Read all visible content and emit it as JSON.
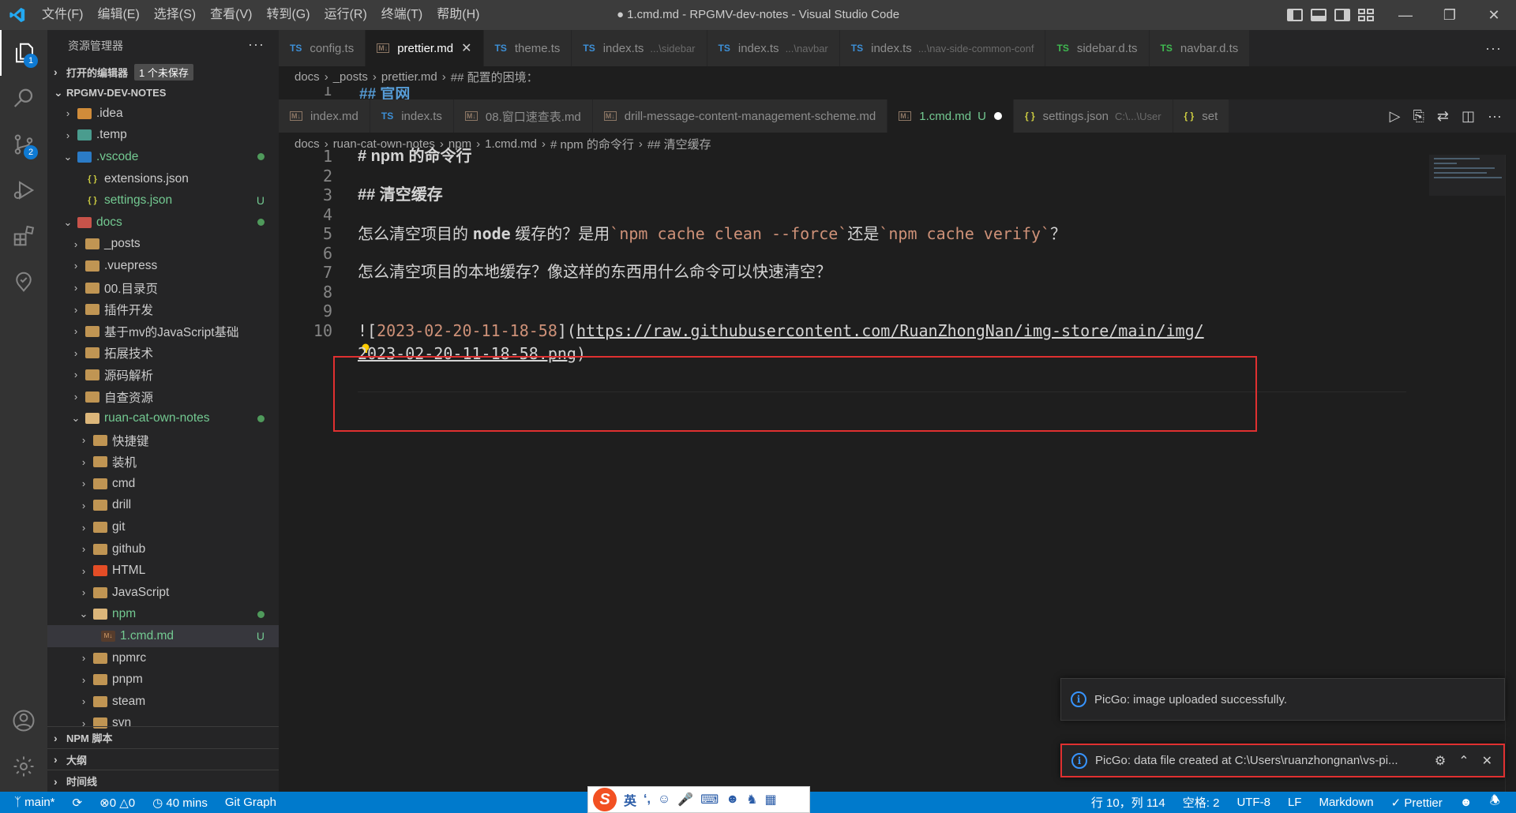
{
  "window": {
    "title": "● 1.cmd.md - RPGMV-dev-notes - Visual Studio Code",
    "menu": [
      "文件(F)",
      "编辑(E)",
      "选择(S)",
      "查看(V)",
      "转到(G)",
      "运行(R)",
      "终端(T)",
      "帮助(H)"
    ]
  },
  "activity": {
    "explorer_badge": "1",
    "scm_badge": "2"
  },
  "sidebar": {
    "header": "资源管理器",
    "open_editors": {
      "label": "打开的编辑器",
      "unsaved": "1 个未保存"
    },
    "root": "RPGMV-DEV-NOTES",
    "tree": [
      {
        "label": ".idea",
        "depth": 1,
        "open": false,
        "icon": "idea"
      },
      {
        "label": ".temp",
        "depth": 1,
        "open": false,
        "icon": "temp"
      },
      {
        "label": ".vscode",
        "depth": 1,
        "open": true,
        "icon": "vscode",
        "dot": true,
        "green": true
      },
      {
        "label": "extensions.json",
        "depth": 2,
        "file": "json"
      },
      {
        "label": "settings.json",
        "depth": 2,
        "file": "json",
        "status": "U",
        "green": true
      },
      {
        "label": "docs",
        "depth": 1,
        "open": true,
        "icon": "docs",
        "dot": true,
        "green": true
      },
      {
        "label": "_posts",
        "depth": 2
      },
      {
        "label": ".vuepress",
        "depth": 2
      },
      {
        "label": "00.目录页",
        "depth": 2
      },
      {
        "label": "插件开发",
        "depth": 2
      },
      {
        "label": "基于mv的JavaScript基础",
        "depth": 2
      },
      {
        "label": "拓展技术",
        "depth": 2
      },
      {
        "label": "源码解析",
        "depth": 2
      },
      {
        "label": "自查资源",
        "depth": 2
      },
      {
        "label": "ruan-cat-own-notes",
        "depth": 2,
        "open": true,
        "dot": true,
        "green": true
      },
      {
        "label": "快捷键",
        "depth": 3
      },
      {
        "label": "装机",
        "depth": 3
      },
      {
        "label": "cmd",
        "depth": 3
      },
      {
        "label": "drill",
        "depth": 3
      },
      {
        "label": "git",
        "depth": 3
      },
      {
        "label": "github",
        "depth": 3
      },
      {
        "label": "HTML",
        "depth": 3,
        "icon": "html"
      },
      {
        "label": "JavaScript",
        "depth": 3
      },
      {
        "label": "npm",
        "depth": 3,
        "open": true,
        "dot": true,
        "green": true
      },
      {
        "label": "1.cmd.md",
        "depth": 4,
        "file": "md",
        "status": "U",
        "green": true,
        "selected": true
      },
      {
        "label": "npmrc",
        "depth": 3
      },
      {
        "label": "pnpm",
        "depth": 3
      },
      {
        "label": "steam",
        "depth": 3
      },
      {
        "label": "svn",
        "depth": 3
      }
    ],
    "bottom_sections": [
      "NPM 脚本",
      "大纲",
      "时间线"
    ]
  },
  "group1": {
    "tabs": [
      {
        "label": "config.ts",
        "kind": "ts"
      },
      {
        "label": "prettier.md",
        "kind": "md",
        "active": true,
        "close": true
      },
      {
        "label": "theme.ts",
        "kind": "ts"
      },
      {
        "label": "index.ts",
        "kind": "ts",
        "desc": "...\\sidebar"
      },
      {
        "label": "index.ts",
        "kind": "ts",
        "desc": "...\\navbar"
      },
      {
        "label": "index.ts",
        "kind": "ts",
        "desc": "...\\nav-side-common-conf"
      },
      {
        "label": "sidebar.d.ts",
        "kind": "dts"
      },
      {
        "label": "navbar.d.ts",
        "kind": "dts"
      }
    ],
    "breadcrumb": [
      "docs",
      "_posts",
      "prettier.md",
      "## 配置的困境："
    ],
    "peek_line": {
      "num": "1",
      "text": "## 官网"
    }
  },
  "group2": {
    "tabs": [
      {
        "label": "index.md",
        "kind": "md"
      },
      {
        "label": "index.ts",
        "kind": "ts"
      },
      {
        "label": "08.窗口速查表.md",
        "kind": "md"
      },
      {
        "label": "drill-message-content-management-scheme.md",
        "kind": "md"
      },
      {
        "label": "1.cmd.md",
        "kind": "md",
        "active": true,
        "status": "U",
        "modified": true
      },
      {
        "label": "settings.json",
        "kind": "json",
        "desc": "C:\\...\\User"
      },
      {
        "label": "set",
        "kind": "json"
      }
    ],
    "breadcrumb": [
      "docs",
      "ruan-cat-own-notes",
      "npm",
      "1.cmd.md",
      "# npm 的命令行",
      "## 清空缓存"
    ]
  },
  "editor": {
    "lines": {
      "l1": "# npm 的命令行",
      "l3": "## 清空缓存",
      "l5_a": "怎么清空项目的 ",
      "l5_b": "node",
      "l5_c": " 缓存的？是用",
      "l5_d": "`npm cache clean --force`",
      "l5_e": "还是",
      "l5_f": "`npm cache verify`",
      "l5_g": "？",
      "l7": "怎么清空项目的本地缓存？像这样的东西用什么命令可以快速清空？",
      "l10_a": "![",
      "l10_b": "2023-02-20-11-18-58",
      "l10_c": "](",
      "l10_d": "https://raw.githubusercontent.com/RuanZhongNan/img-store/main/img/",
      "l10_e": "2023-02-20-11-18-58.png",
      "l10_f": ")"
    },
    "line_numbers": [
      "1",
      "2",
      "3",
      "4",
      "5",
      "6",
      "7",
      "8",
      "9",
      "10"
    ]
  },
  "notifications": [
    {
      "text": "PicGo: image uploaded successfully."
    },
    {
      "text": "PicGo: data file created at C:\\Users\\ruanzhongnan\\vs-pi..."
    }
  ],
  "statusbar": {
    "branch": "main*",
    "errors": "0",
    "warnings": "0",
    "time": "40 mins",
    "git_graph": "Git Graph",
    "position": "行 10，列 114",
    "spaces": "空格: 2",
    "encoding": "UTF-8",
    "eol": "LF",
    "language": "Markdown",
    "prettier": "Prettier"
  },
  "ime": {
    "logo": "S",
    "mode": "英"
  }
}
